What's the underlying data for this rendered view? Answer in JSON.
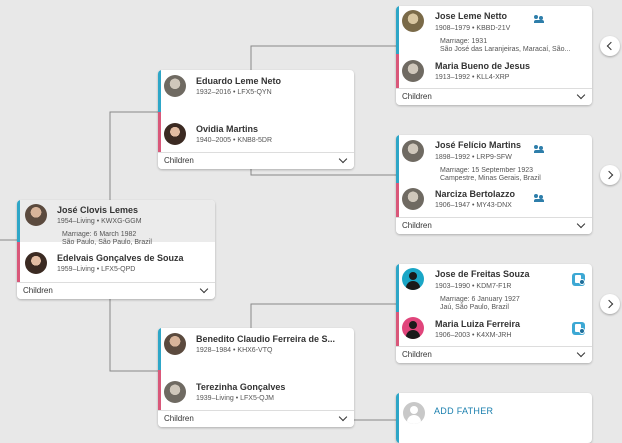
{
  "root_couple": {
    "husband": {
      "name": "José Clovis Lemes",
      "lifespan": "1954–Living",
      "id": "KWXG-GGM"
    },
    "marriage": {
      "date": "Marriage: 6 March 1982",
      "place": "São Paulo, São Paulo, Brazil"
    },
    "wife": {
      "name": "Edelvais Gonçalves de Souza",
      "lifespan": "1959–Living",
      "id": "LFX5-QPD"
    },
    "children_label": "Children"
  },
  "paternal_parents": {
    "father": {
      "name": "Eduardo Leme Neto",
      "lifespan": "1932–2016",
      "id": "LFX5-QYN"
    },
    "mother": {
      "name": "Ovidia Martins",
      "lifespan": "1940–2005",
      "id": "KNB8-5DR"
    },
    "children_label": "Children"
  },
  "maternal_parents": {
    "father": {
      "name": "Benedito Claudio Ferreira de S...",
      "lifespan": "1928–1984",
      "id": "KHX6-VTQ"
    },
    "mother": {
      "name": "Terezinha Gonçalves",
      "lifespan": "1939–Living",
      "id": "LFX5-QJM"
    },
    "children_label": "Children"
  },
  "gp_couple_1": {
    "father": {
      "name": "Jose Leme Netto",
      "lifespan": "1908–1979",
      "id": "KBBD-21V"
    },
    "marriage": {
      "date": "Marriage: 1931",
      "place": "São José das Laranjeiras, Maracaí, São..."
    },
    "mother": {
      "name": "Maria Bueno de Jesus",
      "lifespan": "1913–1992",
      "id": "KLL4-XRP"
    },
    "children_label": "Children"
  },
  "gp_couple_2": {
    "father": {
      "name": "José Felício Martins",
      "lifespan": "1898–1992",
      "id": "LRP9-SFW"
    },
    "marriage": {
      "date": "Marriage: 15 September 1923",
      "place": "Campestre, Minas Gerais, Brazil"
    },
    "mother": {
      "name": "Narciza Bertolazzo",
      "lifespan": "1906–1947",
      "id": "MY43-DNX"
    },
    "children_label": "Children"
  },
  "gp_couple_3": {
    "father": {
      "name": "Jose de Freitas Souza",
      "lifespan": "1903–1990",
      "id": "KDM7-F1R"
    },
    "marriage": {
      "date": "Marriage: 6 January 1927",
      "place": "Jaú, São Paulo, Brazil"
    },
    "mother": {
      "name": "Maria Luiza Ferreira",
      "lifespan": "1906–2003",
      "id": "K4XM-JRH"
    },
    "children_label": "Children"
  },
  "add_father": {
    "label": "ADD FATHER"
  },
  "separator": "•",
  "colors": {
    "male_bar": "#2ea6c7",
    "female_bar": "#d9587a",
    "background": "#e8e8e8",
    "link": "#1a7fae"
  },
  "icons": {
    "record": "people-record-icon",
    "hint": "record-hint-icon",
    "chevron": "chevron-down-icon",
    "nav_left": "chevron-left-icon",
    "nav_right": "chevron-right-icon"
  }
}
